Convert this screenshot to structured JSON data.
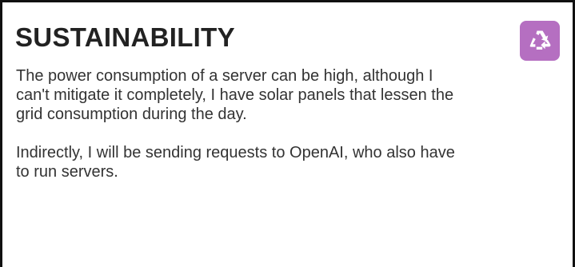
{
  "section": {
    "title": "SUSTAINABILITY",
    "paragraphs": [
      "The power consumption of a server can be high, although I can't mitigate it completely, I have solar panels that lessen the grid consumption during the day.",
      "Indirectly, I will be sending requests to OpenAI, who also have to run servers."
    ],
    "icon": {
      "name": "recycle-icon",
      "background_color": "#b56fc1",
      "foreground_color": "#ffffff"
    }
  }
}
